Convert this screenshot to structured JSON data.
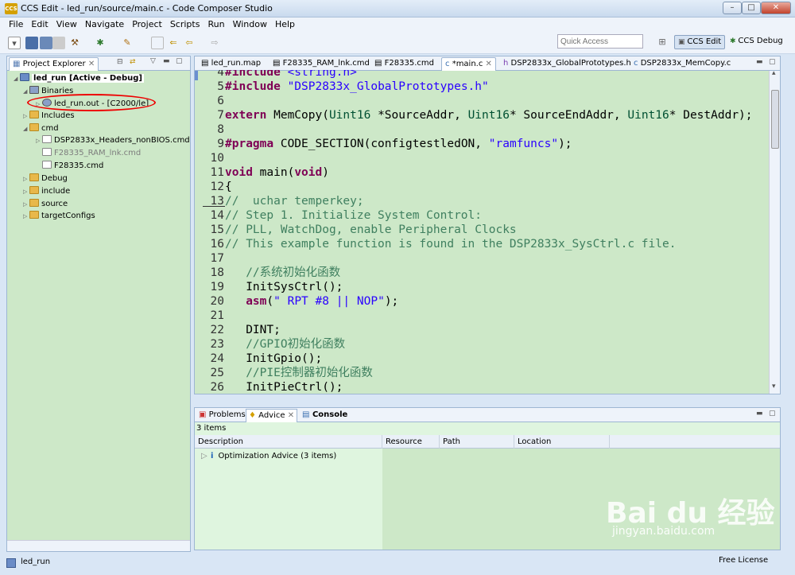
{
  "window": {
    "title": "CCS Edit - led_run/source/main.c - Code Composer Studio",
    "logo_text": "CCS"
  },
  "menu": [
    "File",
    "Edit",
    "View",
    "Navigate",
    "Project",
    "Scripts",
    "Run",
    "Window",
    "Help"
  ],
  "quick_access": {
    "placeholder": "Quick Access"
  },
  "perspectives": {
    "edit": "CCS Edit",
    "debug": "CCS Debug"
  },
  "explorer": {
    "tab": "Project Explorer",
    "project": "led_run  [Active - Debug]",
    "binaries": "Binaries",
    "binary_file": "led_run.out - [C2000/le]",
    "includes": "Includes",
    "cmd": "cmd",
    "cmd_files": [
      "DSP2833x_Headers_nonBIOS.cmd",
      "F28335_RAM_lnk.cmd",
      "F28335.cmd"
    ],
    "folders": [
      "Debug",
      "include",
      "source",
      "targetConfigs"
    ]
  },
  "editor": {
    "tabs": [
      "led_run.map",
      "F28335_RAM_lnk.cmd",
      "F28335.cmd",
      "*main.c",
      "DSP2833x_GlobalPrototypes.h",
      "DSP2833x_MemCopy.c"
    ],
    "lines": [
      {
        "n": "4",
        "segs": [
          [
            "pp",
            "#include "
          ],
          [
            "str",
            "<string.h>"
          ]
        ]
      },
      {
        "n": "5",
        "segs": [
          [
            "pp",
            "#include "
          ],
          [
            "str",
            "\"DSP2833x_GlobalPrototypes.h\""
          ]
        ]
      },
      {
        "n": "6",
        "segs": []
      },
      {
        "n": "7",
        "segs": [
          [
            "kw",
            "extern "
          ],
          [
            "",
            "MemCopy("
          ],
          [
            "ty",
            "Uint16"
          ],
          [
            "",
            " *SourceAddr, "
          ],
          [
            "ty",
            "Uint16"
          ],
          [
            "",
            "* SourceEndAddr, "
          ],
          [
            "ty",
            "Uint16"
          ],
          [
            "",
            "* DestAddr);"
          ]
        ]
      },
      {
        "n": "8",
        "segs": []
      },
      {
        "n": "9",
        "segs": [
          [
            "pp",
            "#pragma "
          ],
          [
            "",
            "CODE_SECTION(configtestledON, "
          ],
          [
            "str",
            "\"ramfuncs\""
          ],
          [
            "",
            ");"
          ]
        ]
      },
      {
        "n": "10",
        "segs": []
      },
      {
        "n": "11",
        "segs": [
          [
            "kw",
            "void "
          ],
          [
            "",
            "main("
          ],
          [
            "kw",
            "void"
          ],
          [
            "",
            ")"
          ]
        ]
      },
      {
        "n": "12",
        "segs": [
          [
            "",
            "{"
          ]
        ]
      },
      {
        "n": "13",
        "segs": [
          [
            "cm",
            "//  uchar temperkey;"
          ]
        ]
      },
      {
        "n": "14",
        "segs": [
          [
            "cm",
            "// Step 1. Initialize System Control:"
          ]
        ]
      },
      {
        "n": "15",
        "segs": [
          [
            "cm",
            "// PLL, WatchDog, enable Peripheral Clocks"
          ]
        ]
      },
      {
        "n": "16",
        "segs": [
          [
            "cm",
            "// This example function is found in the DSP2833x_SysCtrl.c file."
          ]
        ]
      },
      {
        "n": "17",
        "segs": []
      },
      {
        "n": "18",
        "segs": [
          [
            "cm",
            "   //系统初始化函数"
          ]
        ]
      },
      {
        "n": "19",
        "segs": [
          [
            "",
            "   InitSysCtrl();"
          ]
        ]
      },
      {
        "n": "20",
        "segs": [
          [
            "kw",
            "   asm"
          ],
          [
            "",
            "("
          ],
          [
            "str",
            "\" RPT #8 || NOP\""
          ],
          [
            "",
            ");"
          ]
        ]
      },
      {
        "n": "21",
        "segs": []
      },
      {
        "n": "22",
        "segs": [
          [
            "",
            "   DINT;"
          ]
        ]
      },
      {
        "n": "23",
        "segs": [
          [
            "cm",
            "   //GPIO初始化函数"
          ]
        ]
      },
      {
        "n": "24",
        "segs": [
          [
            "",
            "   InitGpio();"
          ]
        ]
      },
      {
        "n": "25",
        "segs": [
          [
            "cm",
            "   //PIE控制器初始化函数"
          ]
        ]
      },
      {
        "n": "26",
        "segs": [
          [
            "",
            "   InitPieCtrl();"
          ]
        ]
      }
    ]
  },
  "bottom": {
    "tabs": [
      "Problems",
      "Advice",
      "Console"
    ],
    "items_count": "3 items",
    "columns": [
      "Description",
      "Resource",
      "Path",
      "Location"
    ],
    "rows": [
      {
        "description": "Optimization Advice (3 items)"
      }
    ]
  },
  "status": {
    "left": "led_run",
    "right": "Free License"
  },
  "watermark": {
    "main": "Bai du 经验",
    "sub": "jingyan.baidu.com"
  }
}
